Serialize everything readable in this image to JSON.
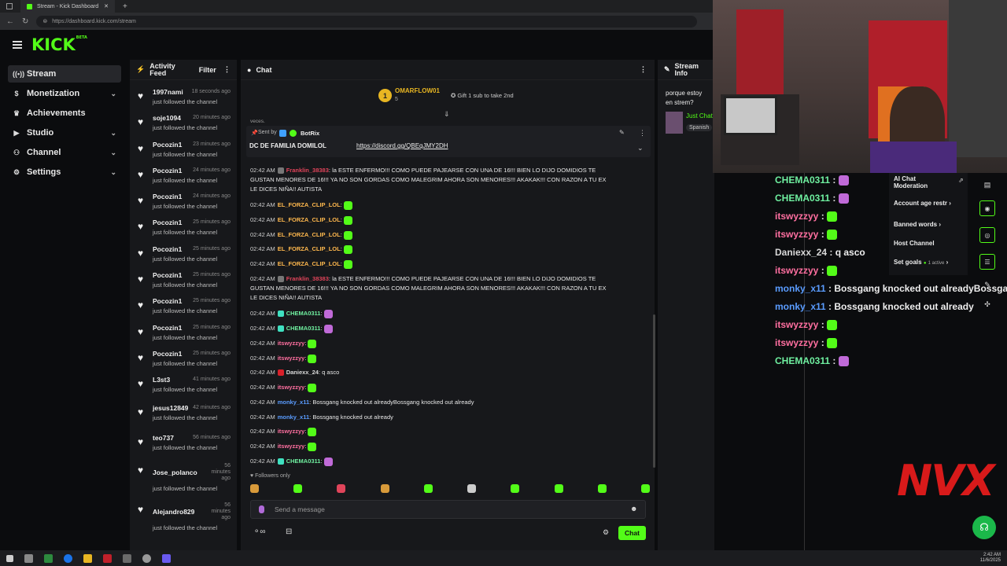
{
  "browser": {
    "tab_title": "Stream - Kick Dashboard",
    "url": "https://dashboard.kick.com/stream",
    "new_tab": "+"
  },
  "app": {
    "logo": "KICK",
    "logo_badge": "BETA"
  },
  "sidebar": {
    "items": [
      {
        "label": "Stream",
        "icon": "broadcast-icon",
        "active": true
      },
      {
        "label": "Monetization",
        "icon": "dollar-icon",
        "chevron": true
      },
      {
        "label": "Achievements",
        "icon": "trophy-icon"
      },
      {
        "label": "Studio",
        "icon": "video-icon",
        "chevron": true
      },
      {
        "label": "Channel",
        "icon": "users-icon",
        "chevron": true
      },
      {
        "label": "Settings",
        "icon": "gear-icon",
        "chevron": true
      }
    ]
  },
  "activity": {
    "title_line1": "Activity",
    "title_line2": "Feed",
    "filter": "Filter",
    "rows": [
      {
        "name": "1997nami",
        "time": "18 seconds ago",
        "desc": "just followed the channel"
      },
      {
        "name": "soje1094",
        "time": "20 minutes ago",
        "desc": "just followed the channel"
      },
      {
        "name": "Pocozin1",
        "time": "23 minutes ago",
        "desc": "just followed the channel"
      },
      {
        "name": "Pocozin1",
        "time": "24 minutes ago",
        "desc": "just followed the channel"
      },
      {
        "name": "Pocozin1",
        "time": "24 minutes ago",
        "desc": "just followed the channel"
      },
      {
        "name": "Pocozin1",
        "time": "25 minutes ago",
        "desc": "just followed the channel"
      },
      {
        "name": "Pocozin1",
        "time": "25 minutes ago",
        "desc": "just followed the channel"
      },
      {
        "name": "Pocozin1",
        "time": "25 minutes ago",
        "desc": "just followed the channel"
      },
      {
        "name": "Pocozin1",
        "time": "25 minutes ago",
        "desc": "just followed the channel"
      },
      {
        "name": "Pocozin1",
        "time": "25 minutes ago",
        "desc": "just followed the channel"
      },
      {
        "name": "Pocozin1",
        "time": "25 minutes ago",
        "desc": "just followed the channel"
      },
      {
        "name": "L3st3",
        "time": "41 minutes ago",
        "desc": "just followed the channel"
      },
      {
        "name": "jesus12849",
        "time": "42 minutes ago",
        "desc": "just followed the channel"
      },
      {
        "name": "teo737",
        "time": "56 minutes ago",
        "desc": "just followed the channel"
      },
      {
        "name": "Jose_polanco",
        "time": "56 minutes ago",
        "desc": "just followed the channel"
      },
      {
        "name": "Alejandro829",
        "time": "56 minutes ago",
        "desc": "just followed the channel"
      }
    ]
  },
  "chat": {
    "title": "Chat",
    "top_gifter": "OMARFLOW01",
    "top_gifter_rank": "1",
    "top_gifter_count": "5",
    "gift_prompt": "Gift 1 sub to take 2nd",
    "truncated_top": "veces.",
    "pinned_sender_prefix": "Sent by",
    "pinned_sender": "BotRix",
    "pinned_text": "DC DE FAMILIA DOMILOL",
    "pinned_link": "https://discord.gg/QBEqJMY2DH",
    "messages": [
      {
        "time": "02:42 AM",
        "user": "Franklin_38383",
        "color": "#e0445a",
        "text": "la ESTE ENFERMO!!! COMO PUEDE PAJEARSE CON UNA DE 16!!! BIEN LO DIJO DOMIDIOS TE",
        "text2": "GUSTAN MENORES DE 16!!! YA NO SON GORDAS COMO MALEGRIM AHORA SON MENORES!!! AKAKAK!!! CON RAZON A TU EX",
        "text3": "LE DICES NIÑA!! AUTISTA"
      },
      {
        "time": "02:42 AM",
        "user": "EL_FORZA_CLIP_LOL",
        "color": "#ffb84d",
        "text": ""
      },
      {
        "time": "02:42 AM",
        "user": "EL_FORZA_CLIP_LOL",
        "color": "#ffb84d",
        "text": ""
      },
      {
        "time": "02:42 AM",
        "user": "EL_FORZA_CLIP_LOL",
        "color": "#ffb84d",
        "text": ""
      },
      {
        "time": "02:42 AM",
        "user": "EL_FORZA_CLIP_LOL",
        "color": "#ffb84d",
        "text": ""
      },
      {
        "time": "02:42 AM",
        "user": "EL_FORZA_CLIP_LOL",
        "color": "#ffb84d",
        "text": ""
      },
      {
        "time": "02:42 AM",
        "user": "Franklin_38383",
        "color": "#e0445a",
        "text": "la ESTE ENFERMO!!! COMO PUEDE PAJEARSE CON UNA DE 16!!! BIEN LO DIJO DOMIDIOS TE",
        "text2": "GUSTAN MENORES DE 16!!! YA NO SON GORDAS COMO MALEGRIM AHORA SON MENORES!!! AKAKAK!!! CON RAZON A TU EX",
        "text3": "LE DICES NIÑA!! AUTISTA"
      },
      {
        "time": "02:42 AM",
        "user": "CHEMA0311",
        "color": "#6ff0a0",
        "text": ""
      },
      {
        "time": "02:42 AM",
        "user": "CHEMA0311",
        "color": "#6ff0a0",
        "text": ""
      },
      {
        "time": "02:42 AM",
        "user": "itswyzzyy",
        "color": "#ff6fa0",
        "text": ""
      },
      {
        "time": "02:42 AM",
        "user": "itswyzzyy",
        "color": "#ff6fa0",
        "text": ""
      },
      {
        "time": "02:42 AM",
        "user": "Daniexx_24",
        "color": "#d8d8d8",
        "text": "q asco"
      },
      {
        "time": "02:42 AM",
        "user": "itswyzzyy",
        "color": "#ff6fa0",
        "text": ""
      },
      {
        "time": "02:42 AM",
        "user": "monky_x11",
        "color": "#5a9cff",
        "text": "Bossgang knocked out alreadyBossgang knocked out already"
      },
      {
        "time": "02:42 AM",
        "user": "monky_x11",
        "color": "#5a9cff",
        "text": "Bossgang knocked out already"
      },
      {
        "time": "02:42 AM",
        "user": "itswyzzyy",
        "color": "#ff6fa0",
        "text": ""
      },
      {
        "time": "02:42 AM",
        "user": "itswyzzyy",
        "color": "#ff6fa0",
        "text": ""
      },
      {
        "time": "02:42 AM",
        "user": "CHEMA0311",
        "color": "#6ff0a0",
        "text": ""
      }
    ],
    "followers_only": "Followers only",
    "input_placeholder": "Send a message",
    "send_label": "Chat"
  },
  "stream_info": {
    "title_line1": "Stream",
    "title_line2": "Info",
    "stream_title_1": "porque estoy",
    "stream_title_2": "en strem?",
    "category": "Just Chatting",
    "language": "Spanish"
  },
  "overlay": {
    "moderation_title_1": "AI Chat",
    "moderation_title_2": "Moderation",
    "mod_items": [
      {
        "label": "Account age restr"
      },
      {
        "label": "Banned words"
      },
      {
        "label": "Host Channel"
      },
      {
        "label": "Set goals",
        "extra": "1 active"
      }
    ],
    "lines": [
      {
        "user": "CHEMA0311",
        "color": "#6ff0a0",
        "text": ""
      },
      {
        "user": "CHEMA0311",
        "color": "#6ff0a0",
        "text": ""
      },
      {
        "user": "itswyzzyy",
        "color": "#ff6fa0",
        "text": ""
      },
      {
        "user": "itswyzzyy",
        "color": "#ff6fa0",
        "text": ""
      },
      {
        "user": "Daniexx_24",
        "color": "#d8d8d8",
        "text": "q asco"
      },
      {
        "user": "itswyzzyy",
        "color": "#ff6fa0",
        "text": ""
      },
      {
        "user": "monky_x11",
        "color": "#5a9cff",
        "text": "Bossgang knocked out alreadyBossgang"
      },
      {
        "user": "monky_x11",
        "color": "#5a9cff",
        "text": "Bossgang knocked out already"
      },
      {
        "user": "itswyzzyy",
        "color": "#ff6fa0",
        "text": ""
      },
      {
        "user": "itswyzzyy",
        "color": "#ff6fa0",
        "text": ""
      },
      {
        "user": "CHEMA0311",
        "color": "#6ff0a0",
        "text": ""
      }
    ],
    "brand_logo": "NVX"
  },
  "taskbar": {
    "time": "2:42 AM",
    "date": "11/6/2025"
  },
  "colors": {
    "accent": "#53fc18",
    "background": "#0b0c0e",
    "panel": "#17181b"
  }
}
